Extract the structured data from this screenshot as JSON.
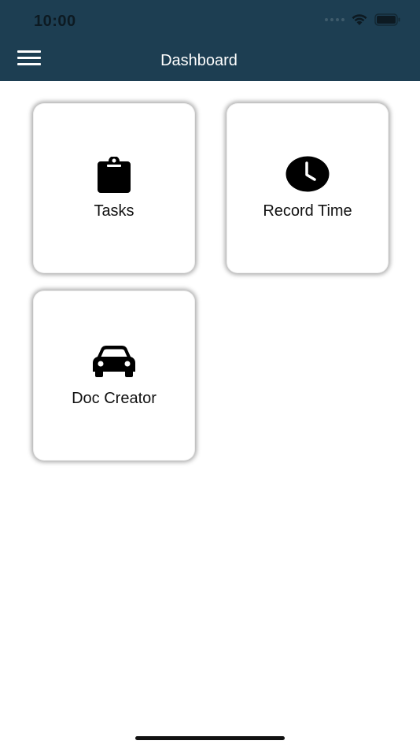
{
  "status_bar": {
    "time": "10:00",
    "icons": [
      "cellular-dots-icon",
      "wifi-icon",
      "battery-icon"
    ]
  },
  "header": {
    "title": "Dashboard",
    "menu_icon": "hamburger-menu-icon",
    "background_color": "#1d3e52"
  },
  "tiles": [
    {
      "label": "Tasks",
      "icon": "clipboard-icon"
    },
    {
      "label": "Record Time",
      "icon": "clock-icon"
    },
    {
      "label": "Doc Creator",
      "icon": "car-icon"
    }
  ]
}
